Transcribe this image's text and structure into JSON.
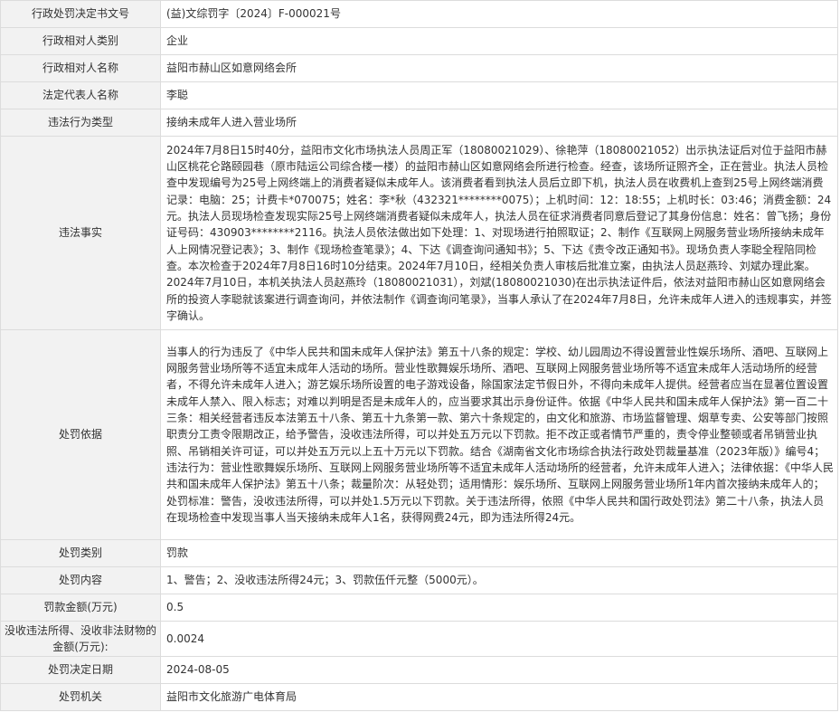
{
  "rows": [
    {
      "label": "行政处罚决定书文号",
      "value": "(益)文综罚字〔2024〕F-000021号"
    },
    {
      "label": "行政相对人类别",
      "value": "企业"
    },
    {
      "label": "行政相对人名称",
      "value": "益阳市赫山区如意网络会所"
    },
    {
      "label": "法定代表人名称",
      "value": "李聪"
    },
    {
      "label": "违法行为类型",
      "value": "接纳未成年人进入营业场所"
    },
    {
      "label": "违法事实",
      "value": "2024年7月8日15时40分，益阳市文化市场执法人员周正军（18080021029）、徐艳萍（18080021052）出示执法证后对位于益阳市赫山区桃花仑路颐园巷（原市陆运公司综合楼一楼）的益阳市赫山区如意网络会所进行检查。经查，该场所证照齐全，正在营业。执法人员检查中发现编号为25号上网终端上的消费者疑似未成年人。该消费者看到执法人员后立即下机，执法人员在收费机上查到25号上网终端消费记录：电脑：25；计费卡*070075；姓名：李*秋（432321********0075）；上机时间：12：18:55；上机时长：03:46；消费金额：24元。执法人员现场检查发现实际25号上网终端消费者疑似未成年人，执法人员在征求消费者同意后登记了其身份信息：姓名：曾飞扬；身份证号码：430903********2116。执法人员依法做出如下处理：1、对现场进行拍照取证；2、制作《互联网上网服务营业场所接纳未成年人上网情况登记表》；3、制作《现场检查笔录》；4、下达《调查询问通知书》；5、下达《责令改正通知书》。现场负责人李聪全程陪同检查。本次检查于2024年7月8日16时10分结束。2024年7月10日，经相关负责人审核后批准立案，由执法人员赵燕玲、刘斌办理此案。2024年7月10日，本机关执法人员赵燕玲（18080021031），刘斌(18080021030)在出示执法证件后，依法对益阳市赫山区如意网络会所的投资人李聪就该案进行调查询问，并依法制作《调查询问笔录》，当事人承认了在2024年7月8日，允许未成年人进入的违规事实，并签字确认。"
    },
    {
      "label": "处罚依据",
      "value": "当事人的行为违反了《中华人民共和国未成年人保护法》第五十八条的规定：学校、幼儿园周边不得设置营业性娱乐场所、酒吧、互联网上网服务营业场所等不适宜未成年人活动的场所。营业性歌舞娱乐场所、酒吧、互联网上网服务营业场所等不适宜未成年人活动场所的经营者，不得允许未成年人进入；游艺娱乐场所设置的电子游戏设备，除国家法定节假日外，不得向未成年人提供。经营者应当在显著位置设置未成年人禁入、限入标志；对难以判明是否是未成年人的，应当要求其出示身份证件。依据《中华人民共和国未成年人保护法》第一百二十三条：相关经营者违反本法第五十八条、第五十九条第一款、第六十条规定的，由文化和旅游、市场监督管理、烟草专卖、公安等部门按照职责分工责令限期改正，给予警告，没收违法所得，可以并处五万元以下罚款。拒不改正或者情节严重的，责令停业整顿或者吊销营业执照、吊销相关许可证，可以并处五万元以上五十万元以下罚款。结合《湖南省文化市场综合执法行政处罚裁量基准（2023年版）》编号4；违法行为：营业性歌舞娱乐场所、互联网上网服务营业场所等不适宜未成年人活动场所的经营者，允许未成年人进入；法律依据：《中华人民共和国未成年人保护法》第五十八条；裁量阶次：从轻处罚；适用情形：娱乐场所、互联网上网服务营业场所1年内首次接纳未成年人的；处罚标准：警告，没收违法所得，可以并处1.5万元以下罚款。关于违法所得，依照《中华人民共和国行政处罚法》第二十八条，执法人员在现场检查中发现当事人当天接纳未成年人1名，获得网费24元，即为违法所得24元。"
    },
    {
      "label": "处罚类别",
      "value": "罚款"
    },
    {
      "label": "处罚内容",
      "value": "1、警告；2、没收违法所得24元；3、罚款伍仟元整（5000元）。"
    },
    {
      "label": "罚款金额(万元)",
      "value": "0.5"
    },
    {
      "label": "没收违法所得、没收非法财物的金额(万元):",
      "value": "0.0024"
    },
    {
      "label": "处罚决定日期",
      "value": "2024-08-05"
    },
    {
      "label": "处罚机关",
      "value": "益阳市文化旅游广电体育局"
    }
  ]
}
